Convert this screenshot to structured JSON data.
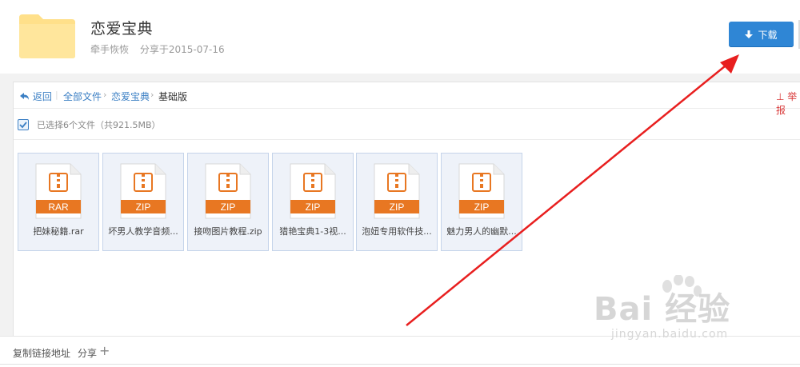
{
  "header": {
    "title": "恋爱宝典",
    "author": "牵手恢恢",
    "share_date": "分享于2015-07-16",
    "download_label": "下载",
    "folder_color": "#ffe08a"
  },
  "breadcrumb": {
    "back": "返回",
    "items": [
      "全部文件",
      "恋爱宝典",
      "基础版"
    ],
    "report": "举报"
  },
  "selection": {
    "text": "已选择6个文件（共921.5MB）"
  },
  "files": [
    {
      "type": "RAR",
      "name": "把妹秘籍.rar"
    },
    {
      "type": "ZIP",
      "name": "坏男人教学音频..."
    },
    {
      "type": "ZIP",
      "name": "接吻图片教程.zip"
    },
    {
      "type": "ZIP",
      "name": "猎艳宝典1-3视..."
    },
    {
      "type": "ZIP",
      "name": "泡妞专用软件技..."
    },
    {
      "type": "ZIP",
      "name": "魅力男人的幽默..."
    }
  ],
  "footer": {
    "copy_link": "复制链接地址",
    "share": "分享",
    "plus": "+"
  },
  "watermark": {
    "text": "Bai 经验",
    "sub": "jingyan.baidu.com"
  },
  "colors": {
    "accent": "#2f86d5",
    "file_badge": "#e87722",
    "arrow": "#e81f1f"
  }
}
